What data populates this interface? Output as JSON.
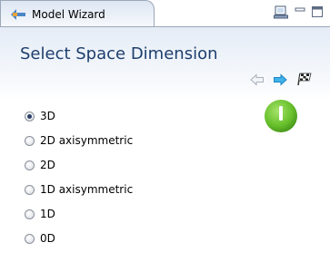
{
  "tab": {
    "title": "Model Wizard",
    "icon": "model-wizard-icon"
  },
  "window_controls": {
    "view_menu_icon": "view-menu-icon",
    "minimize_icon": "minimize-icon",
    "maximize_icon": "maximize-icon"
  },
  "header": {
    "title": "Select Space Dimension",
    "nav": {
      "back_icon": "back-arrow-icon",
      "next_icon": "next-arrow-icon",
      "finish_icon": "checkered-flag-icon"
    }
  },
  "status": {
    "icon": "green-status-indicator",
    "color": "#66bf2a"
  },
  "dimension_options": [
    {
      "label": "3D",
      "selected": true
    },
    {
      "label": "2D axisymmetric",
      "selected": false
    },
    {
      "label": "2D",
      "selected": false
    },
    {
      "label": "1D axisymmetric",
      "selected": false
    },
    {
      "label": "1D",
      "selected": false
    },
    {
      "label": "0D",
      "selected": false
    }
  ],
  "colors": {
    "title": "#1d3e6e",
    "next_arrow": "#2aa3e0",
    "tab_border": "#9aa7b8"
  }
}
